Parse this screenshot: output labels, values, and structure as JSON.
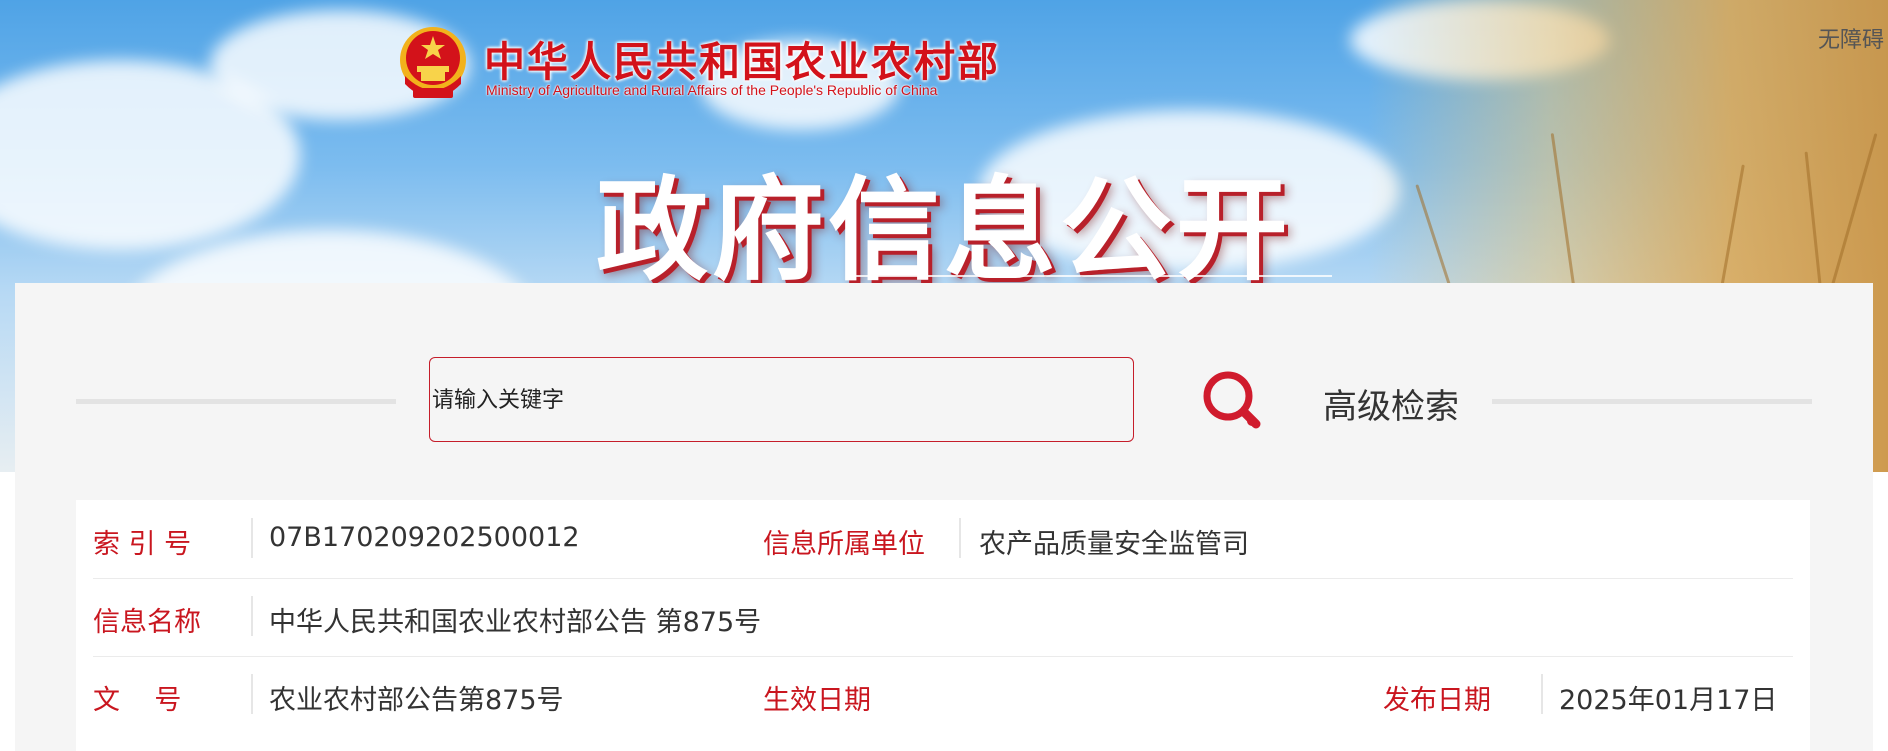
{
  "header": {
    "site_title": "中华人民共和国农业农村部",
    "site_subtitle": "Ministry of Agriculture and Rural Affairs of the People's Republic of China",
    "accessibility_label": "无障碍",
    "hero_title": "政府信息公开",
    "emblem_icon": "national-emblem-icon"
  },
  "search": {
    "placeholder": "请输入关键字",
    "button_icon": "search-icon",
    "advanced_label": "高级检索"
  },
  "info": {
    "index_label": "索 引 号",
    "index_value": "07B170209202500012",
    "unit_label": "信息所属单位",
    "unit_value": "农产品质量安全监管司",
    "name_label": "信息名称",
    "name_value": "中华人民共和国农业农村部公告 第875号",
    "doc_label": "文    号",
    "doc_value": "农业农村部公告第875号",
    "effective_label": "生效日期",
    "effective_value": "",
    "publish_label": "发布日期",
    "publish_value": "2025年01月17日"
  },
  "colors": {
    "accent_red": "#c9161f",
    "banner_sky": "#4fa3e6"
  }
}
